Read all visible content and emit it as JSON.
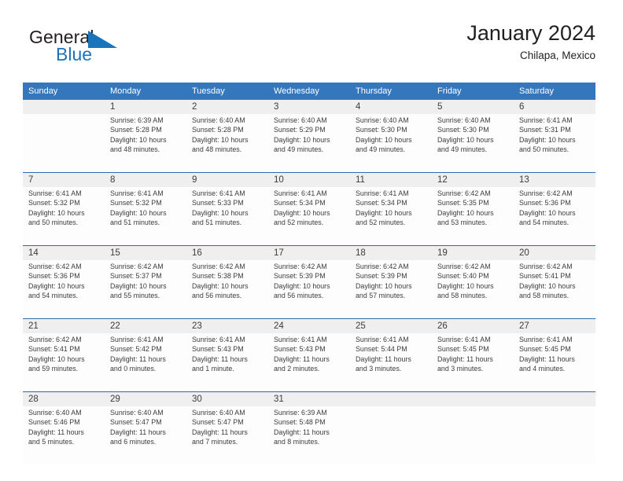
{
  "brand": {
    "name_top": "General",
    "name_bottom": "Blue",
    "mark": "triangle-flag-icon",
    "color_top": "#231f20",
    "color_bottom": "#1a74bb"
  },
  "header": {
    "title": "January 2024",
    "subtitle": "Chilapa, Mexico"
  },
  "theme": {
    "header_blue": "#3577bd",
    "row_rule_blue": "#2b6cad",
    "daynum_band": "#efefef",
    "cell_bg": "#fdfdfd",
    "text": "#3c3c3c"
  },
  "weekday_headers": [
    "Sunday",
    "Monday",
    "Tuesday",
    "Wednesday",
    "Thursday",
    "Friday",
    "Saturday"
  ],
  "labels": {
    "sunrise": "Sunrise:",
    "sunset": "Sunset:",
    "daylight": "Daylight:"
  },
  "weeks": [
    {
      "days": [
        {
          "num": "",
          "sunrise": "",
          "sunset": "",
          "daylight_1": "",
          "daylight_2": ""
        },
        {
          "num": "1",
          "sunrise": "Sunrise: 6:39 AM",
          "sunset": "Sunset: 5:28 PM",
          "daylight_1": "Daylight: 10 hours",
          "daylight_2": "and 48 minutes."
        },
        {
          "num": "2",
          "sunrise": "Sunrise: 6:40 AM",
          "sunset": "Sunset: 5:28 PM",
          "daylight_1": "Daylight: 10 hours",
          "daylight_2": "and 48 minutes."
        },
        {
          "num": "3",
          "sunrise": "Sunrise: 6:40 AM",
          "sunset": "Sunset: 5:29 PM",
          "daylight_1": "Daylight: 10 hours",
          "daylight_2": "and 49 minutes."
        },
        {
          "num": "4",
          "sunrise": "Sunrise: 6:40 AM",
          "sunset": "Sunset: 5:30 PM",
          "daylight_1": "Daylight: 10 hours",
          "daylight_2": "and 49 minutes."
        },
        {
          "num": "5",
          "sunrise": "Sunrise: 6:40 AM",
          "sunset": "Sunset: 5:30 PM",
          "daylight_1": "Daylight: 10 hours",
          "daylight_2": "and 49 minutes."
        },
        {
          "num": "6",
          "sunrise": "Sunrise: 6:41 AM",
          "sunset": "Sunset: 5:31 PM",
          "daylight_1": "Daylight: 10 hours",
          "daylight_2": "and 50 minutes."
        }
      ]
    },
    {
      "days": [
        {
          "num": "7",
          "sunrise": "Sunrise: 6:41 AM",
          "sunset": "Sunset: 5:32 PM",
          "daylight_1": "Daylight: 10 hours",
          "daylight_2": "and 50 minutes."
        },
        {
          "num": "8",
          "sunrise": "Sunrise: 6:41 AM",
          "sunset": "Sunset: 5:32 PM",
          "daylight_1": "Daylight: 10 hours",
          "daylight_2": "and 51 minutes."
        },
        {
          "num": "9",
          "sunrise": "Sunrise: 6:41 AM",
          "sunset": "Sunset: 5:33 PM",
          "daylight_1": "Daylight: 10 hours",
          "daylight_2": "and 51 minutes."
        },
        {
          "num": "10",
          "sunrise": "Sunrise: 6:41 AM",
          "sunset": "Sunset: 5:34 PM",
          "daylight_1": "Daylight: 10 hours",
          "daylight_2": "and 52 minutes."
        },
        {
          "num": "11",
          "sunrise": "Sunrise: 6:41 AM",
          "sunset": "Sunset: 5:34 PM",
          "daylight_1": "Daylight: 10 hours",
          "daylight_2": "and 52 minutes."
        },
        {
          "num": "12",
          "sunrise": "Sunrise: 6:42 AM",
          "sunset": "Sunset: 5:35 PM",
          "daylight_1": "Daylight: 10 hours",
          "daylight_2": "and 53 minutes."
        },
        {
          "num": "13",
          "sunrise": "Sunrise: 6:42 AM",
          "sunset": "Sunset: 5:36 PM",
          "daylight_1": "Daylight: 10 hours",
          "daylight_2": "and 54 minutes."
        }
      ]
    },
    {
      "days": [
        {
          "num": "14",
          "sunrise": "Sunrise: 6:42 AM",
          "sunset": "Sunset: 5:36 PM",
          "daylight_1": "Daylight: 10 hours",
          "daylight_2": "and 54 minutes."
        },
        {
          "num": "15",
          "sunrise": "Sunrise: 6:42 AM",
          "sunset": "Sunset: 5:37 PM",
          "daylight_1": "Daylight: 10 hours",
          "daylight_2": "and 55 minutes."
        },
        {
          "num": "16",
          "sunrise": "Sunrise: 6:42 AM",
          "sunset": "Sunset: 5:38 PM",
          "daylight_1": "Daylight: 10 hours",
          "daylight_2": "and 56 minutes."
        },
        {
          "num": "17",
          "sunrise": "Sunrise: 6:42 AM",
          "sunset": "Sunset: 5:39 PM",
          "daylight_1": "Daylight: 10 hours",
          "daylight_2": "and 56 minutes."
        },
        {
          "num": "18",
          "sunrise": "Sunrise: 6:42 AM",
          "sunset": "Sunset: 5:39 PM",
          "daylight_1": "Daylight: 10 hours",
          "daylight_2": "and 57 minutes."
        },
        {
          "num": "19",
          "sunrise": "Sunrise: 6:42 AM",
          "sunset": "Sunset: 5:40 PM",
          "daylight_1": "Daylight: 10 hours",
          "daylight_2": "and 58 minutes."
        },
        {
          "num": "20",
          "sunrise": "Sunrise: 6:42 AM",
          "sunset": "Sunset: 5:41 PM",
          "daylight_1": "Daylight: 10 hours",
          "daylight_2": "and 58 minutes."
        }
      ]
    },
    {
      "days": [
        {
          "num": "21",
          "sunrise": "Sunrise: 6:42 AM",
          "sunset": "Sunset: 5:41 PM",
          "daylight_1": "Daylight: 10 hours",
          "daylight_2": "and 59 minutes."
        },
        {
          "num": "22",
          "sunrise": "Sunrise: 6:41 AM",
          "sunset": "Sunset: 5:42 PM",
          "daylight_1": "Daylight: 11 hours",
          "daylight_2": "and 0 minutes."
        },
        {
          "num": "23",
          "sunrise": "Sunrise: 6:41 AM",
          "sunset": "Sunset: 5:43 PM",
          "daylight_1": "Daylight: 11 hours",
          "daylight_2": "and 1 minute."
        },
        {
          "num": "24",
          "sunrise": "Sunrise: 6:41 AM",
          "sunset": "Sunset: 5:43 PM",
          "daylight_1": "Daylight: 11 hours",
          "daylight_2": "and 2 minutes."
        },
        {
          "num": "25",
          "sunrise": "Sunrise: 6:41 AM",
          "sunset": "Sunset: 5:44 PM",
          "daylight_1": "Daylight: 11 hours",
          "daylight_2": "and 3 minutes."
        },
        {
          "num": "26",
          "sunrise": "Sunrise: 6:41 AM",
          "sunset": "Sunset: 5:45 PM",
          "daylight_1": "Daylight: 11 hours",
          "daylight_2": "and 3 minutes."
        },
        {
          "num": "27",
          "sunrise": "Sunrise: 6:41 AM",
          "sunset": "Sunset: 5:45 PM",
          "daylight_1": "Daylight: 11 hours",
          "daylight_2": "and 4 minutes."
        }
      ]
    },
    {
      "days": [
        {
          "num": "28",
          "sunrise": "Sunrise: 6:40 AM",
          "sunset": "Sunset: 5:46 PM",
          "daylight_1": "Daylight: 11 hours",
          "daylight_2": "and 5 minutes."
        },
        {
          "num": "29",
          "sunrise": "Sunrise: 6:40 AM",
          "sunset": "Sunset: 5:47 PM",
          "daylight_1": "Daylight: 11 hours",
          "daylight_2": "and 6 minutes."
        },
        {
          "num": "30",
          "sunrise": "Sunrise: 6:40 AM",
          "sunset": "Sunset: 5:47 PM",
          "daylight_1": "Daylight: 11 hours",
          "daylight_2": "and 7 minutes."
        },
        {
          "num": "31",
          "sunrise": "Sunrise: 6:39 AM",
          "sunset": "Sunset: 5:48 PM",
          "daylight_1": "Daylight: 11 hours",
          "daylight_2": "and 8 minutes."
        },
        {
          "num": "",
          "sunrise": "",
          "sunset": "",
          "daylight_1": "",
          "daylight_2": ""
        },
        {
          "num": "",
          "sunrise": "",
          "sunset": "",
          "daylight_1": "",
          "daylight_2": ""
        },
        {
          "num": "",
          "sunrise": "",
          "sunset": "",
          "daylight_1": "",
          "daylight_2": ""
        }
      ]
    }
  ]
}
